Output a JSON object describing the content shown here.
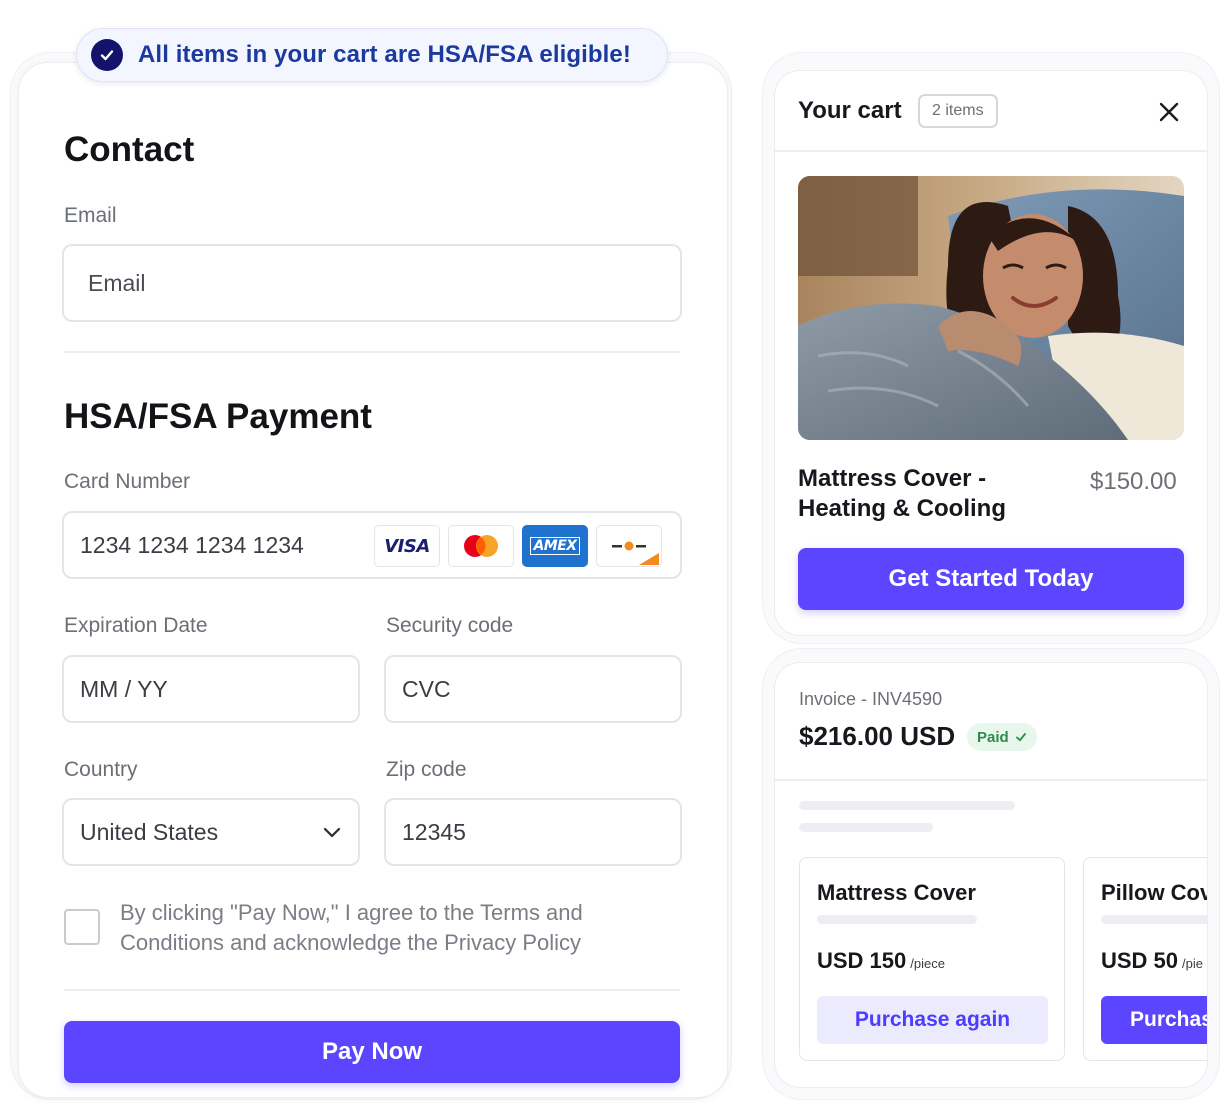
{
  "banner": {
    "text": "All items in your cart are HSA/FSA eligible!"
  },
  "contact": {
    "heading": "Contact",
    "email_label": "Email",
    "email_placeholder": "Email"
  },
  "payment": {
    "heading": "HSA/FSA Payment",
    "card_label": "Card Number",
    "card_placeholder": "1234 1234 1234 1234",
    "brands": [
      "VISA",
      "mastercard",
      "AMEX",
      "discover"
    ],
    "exp_label": "Expiration Date",
    "exp_placeholder": "MM / YY",
    "cvc_label": "Security code",
    "cvc_placeholder": "CVC",
    "country_label": "Country",
    "country_value": "United States",
    "zip_label": "Zip code",
    "zip_value": "12345",
    "terms": "By clicking \"Pay Now,\" I agree to the Terms and Conditions  and acknowledge the Privacy Policy",
    "pay_button": "Pay Now"
  },
  "cart": {
    "title": "Your cart",
    "badge": "2 items",
    "product_name": "Mattress Cover - Heating & Cooling",
    "product_price": "$150.00",
    "cta": "Get Started Today"
  },
  "invoice": {
    "label": "Invoice - INV4590",
    "amount": "$216.00 USD",
    "status": "Paid",
    "items": [
      {
        "name": "Mattress Cover",
        "price": "USD 150",
        "unit": "/piece",
        "button": "Purchase again"
      },
      {
        "name": "Pillow Cov",
        "price": "USD 50",
        "unit": "/pie",
        "button": "Purchase"
      }
    ]
  },
  "colors": {
    "accent": "#5b45ff",
    "banner_text": "#1b3a9f",
    "paid_green": "#2d8a4a"
  }
}
